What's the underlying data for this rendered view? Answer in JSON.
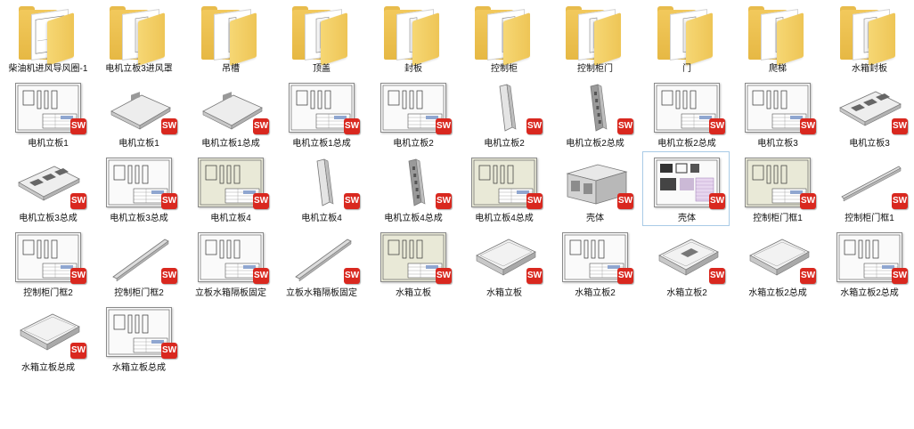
{
  "items": [
    {
      "label": "柴油机进风导风圈-1",
      "kind": "folder",
      "icon": "folder-icon"
    },
    {
      "label": "电机立板3进风罩",
      "kind": "folder",
      "icon": "folder-icon"
    },
    {
      "label": "吊槽",
      "kind": "folder",
      "icon": "folder-icon"
    },
    {
      "label": "顶盖",
      "kind": "folder",
      "icon": "folder-icon"
    },
    {
      "label": "封板",
      "kind": "folder",
      "icon": "folder-icon"
    },
    {
      "label": "控制柜",
      "kind": "folder",
      "icon": "folder-icon"
    },
    {
      "label": "控制柜门",
      "kind": "folder",
      "icon": "folder-icon"
    },
    {
      "label": "门",
      "kind": "folder",
      "icon": "folder-icon"
    },
    {
      "label": "爬梯",
      "kind": "folder",
      "icon": "folder-icon"
    },
    {
      "label": "水箱封板",
      "kind": "folder",
      "icon": "folder-icon"
    },
    {
      "label": "电机立板1",
      "kind": "drawing",
      "icon": "solidworks-drawing-icon"
    },
    {
      "label": "电机立板1",
      "kind": "part-plate",
      "icon": "solidworks-part-icon"
    },
    {
      "label": "电机立板1总成",
      "kind": "part-plate",
      "icon": "solidworks-assembly-icon"
    },
    {
      "label": "电机立板1总成",
      "kind": "drawing",
      "icon": "solidworks-drawing-icon"
    },
    {
      "label": "电机立板2",
      "kind": "drawing",
      "icon": "solidworks-drawing-icon"
    },
    {
      "label": "电机立板2",
      "kind": "part-column",
      "icon": "solidworks-part-icon"
    },
    {
      "label": "电机立板2总成",
      "kind": "part-column-dark",
      "icon": "solidworks-assembly-icon"
    },
    {
      "label": "电机立板2总成",
      "kind": "drawing",
      "icon": "solidworks-drawing-icon"
    },
    {
      "label": "电机立板3",
      "kind": "drawing",
      "icon": "solidworks-drawing-icon"
    },
    {
      "label": "电机立板3",
      "kind": "part-vent",
      "icon": "solidworks-part-icon"
    },
    {
      "label": "电机立板3总成",
      "kind": "part-vent",
      "icon": "solidworks-assembly-icon"
    },
    {
      "label": "电机立板3总成",
      "kind": "drawing",
      "icon": "solidworks-drawing-icon"
    },
    {
      "label": "电机立板4",
      "kind": "drawing-shaded",
      "icon": "solidworks-drawing-icon"
    },
    {
      "label": "电机立板4",
      "kind": "part-column",
      "icon": "solidworks-part-icon"
    },
    {
      "label": "电机立板4总成",
      "kind": "part-column-dark",
      "icon": "solidworks-assembly-icon"
    },
    {
      "label": "电机立板4总成",
      "kind": "drawing-shaded",
      "icon": "solidworks-drawing-icon"
    },
    {
      "label": "壳体",
      "kind": "part-box",
      "icon": "solidworks-assembly-icon"
    },
    {
      "label": "壳体",
      "kind": "drawing-color",
      "icon": "solidworks-drawing-icon",
      "selected": true
    },
    {
      "label": "控制柜门框1",
      "kind": "drawing-shaded",
      "icon": "solidworks-drawing-icon"
    },
    {
      "label": "控制柜门框1",
      "kind": "part-bar",
      "icon": "solidworks-part-icon"
    },
    {
      "label": "控制柜门框2",
      "kind": "drawing",
      "icon": "solidworks-drawing-icon"
    },
    {
      "label": "控制柜门框2",
      "kind": "part-bar-diag",
      "icon": "solidworks-part-icon"
    },
    {
      "label": "立板水箱隔板固定",
      "kind": "drawing",
      "icon": "solidworks-drawing-icon"
    },
    {
      "label": "立板水箱隔板固定",
      "kind": "part-bar-diag",
      "icon": "solidworks-part-icon"
    },
    {
      "label": "水箱立板",
      "kind": "drawing-shaded",
      "icon": "solidworks-drawing-icon"
    },
    {
      "label": "水箱立板",
      "kind": "part-tray",
      "icon": "solidworks-part-icon"
    },
    {
      "label": "水箱立板2",
      "kind": "drawing",
      "icon": "solidworks-drawing-icon"
    },
    {
      "label": "水箱立板2",
      "kind": "part-tray-grid",
      "icon": "solidworks-part-icon"
    },
    {
      "label": "水箱立板2总成",
      "kind": "part-tray",
      "icon": "solidworks-assembly-icon"
    },
    {
      "label": "水箱立板2总成",
      "kind": "drawing",
      "icon": "solidworks-drawing-icon"
    },
    {
      "label": "水箱立板总成",
      "kind": "part-tray",
      "icon": "solidworks-assembly-icon"
    },
    {
      "label": "水箱立板总成",
      "kind": "drawing",
      "icon": "solidworks-drawing-icon"
    }
  ],
  "badge_text": "SW",
  "colors": {
    "badge": "#d9281f",
    "selection_border": "#a9cbe6",
    "folder": "#f2c95c"
  }
}
